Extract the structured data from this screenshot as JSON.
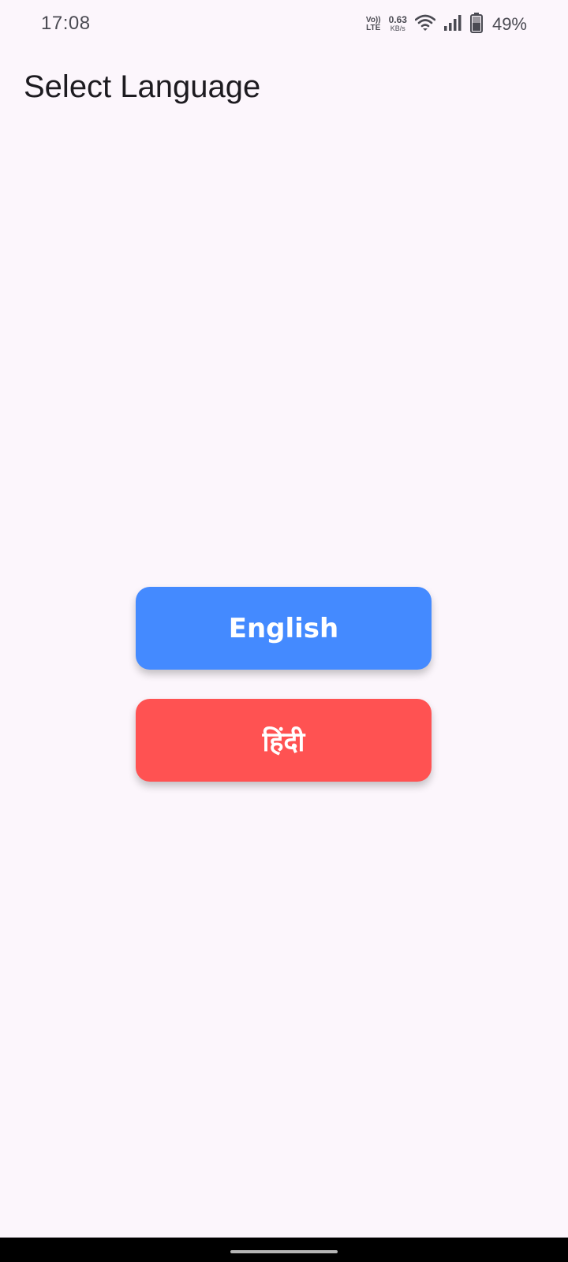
{
  "status_bar": {
    "time": "17:08",
    "volte_top": "Vo))",
    "volte_bottom": "LTE",
    "net_speed_value": "0.63",
    "net_speed_unit": "KB/s",
    "battery_percent": "49%",
    "icons": [
      "wifi-icon",
      "signal-icon",
      "battery-icon"
    ]
  },
  "header": {
    "title": "Select Language"
  },
  "languages": {
    "english_label": "English",
    "hindi_label": "हिंदी"
  },
  "colors": {
    "background": "#fcf6fc",
    "english_button": "#448aff",
    "hindi_button": "#ff5252"
  }
}
